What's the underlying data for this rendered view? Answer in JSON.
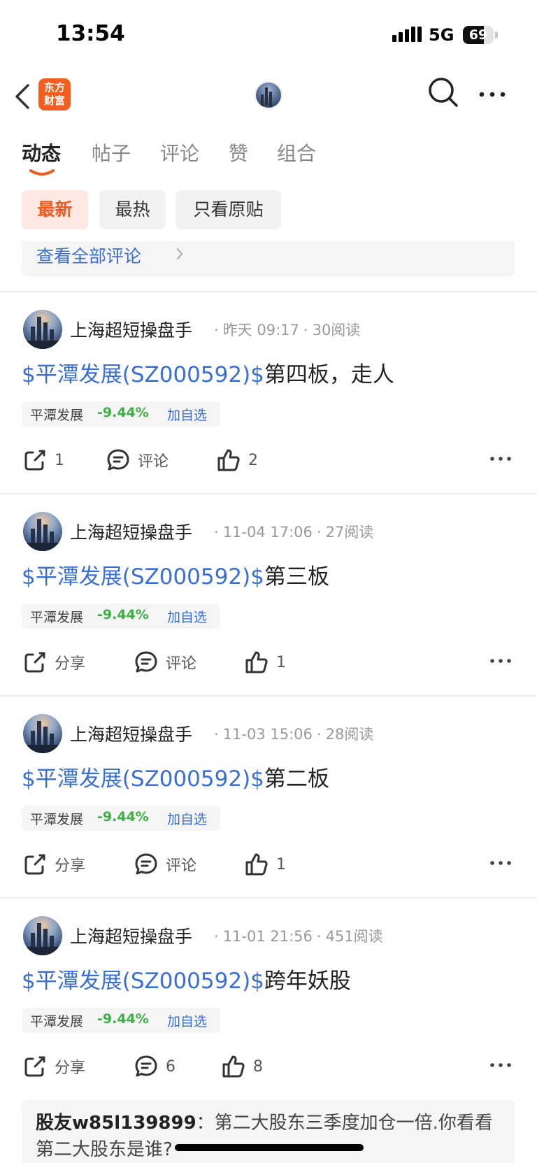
{
  "status_bar": {
    "time": "13:54",
    "network": "5G",
    "battery": "69",
    "battery_level": 0.69
  },
  "nav": {
    "back_icon": "chevron-left-icon",
    "app_logo_text_line1": "东方",
    "app_logo_text_line2": "财富",
    "search_icon": "search-icon",
    "more_icon": "more-horizontal-icon"
  },
  "tabs": [
    {
      "label": "动态",
      "active": true
    },
    {
      "label": "帖子",
      "active": false
    },
    {
      "label": "评论",
      "active": false
    },
    {
      "label": "赞",
      "active": false
    },
    {
      "label": "组合",
      "active": false
    }
  ],
  "filters": [
    {
      "label": "最新",
      "active": true
    },
    {
      "label": "最热",
      "active": false
    },
    {
      "label": "只看原贴",
      "active": false
    }
  ],
  "view_all_comments": "查看全部评论",
  "posts": [
    {
      "author": "上海超短操盘手",
      "time": "昨天 09:17",
      "reads": "30阅读",
      "tag": "$平潭发展(SZ000592)$",
      "text": "第四板，走人",
      "stock_name": "平潭发展",
      "stock_change": "-9.44%",
      "follow_label": "加自选",
      "share_label": "1",
      "comment_label": "评论",
      "like_label": "2"
    },
    {
      "author": "上海超短操盘手",
      "time": "11-04 17:06",
      "reads": "27阅读",
      "tag": "$平潭发展(SZ000592)$",
      "text": "第三板",
      "stock_name": "平潭发展",
      "stock_change": "-9.44%",
      "follow_label": "加自选",
      "share_label": "分享",
      "comment_label": "评论",
      "like_label": "1"
    },
    {
      "author": "上海超短操盘手",
      "time": "11-03 15:06",
      "reads": "28阅读",
      "tag": "$平潭发展(SZ000592)$",
      "text": "第二板",
      "stock_name": "平潭发展",
      "stock_change": "-9.44%",
      "follow_label": "加自选",
      "share_label": "分享",
      "comment_label": "评论",
      "like_label": "1"
    },
    {
      "author": "上海超短操盘手",
      "time": "11-01 21:56",
      "reads": "451阅读",
      "tag": "$平潭发展(SZ000592)$",
      "text": "跨年妖股",
      "stock_name": "平潭发展",
      "stock_change": "-9.44%",
      "follow_label": "加自选",
      "share_label": "分享",
      "comment_label": "6",
      "like_label": "8"
    }
  ],
  "reply": {
    "user": "股友w85l139899",
    "text": "：第二大股东三季度加仓一倍.你看看第二大股东是谁?"
  },
  "colors": {
    "accent": "#f05a1e",
    "link": "#3a6fd8",
    "down": "#3cb044"
  }
}
